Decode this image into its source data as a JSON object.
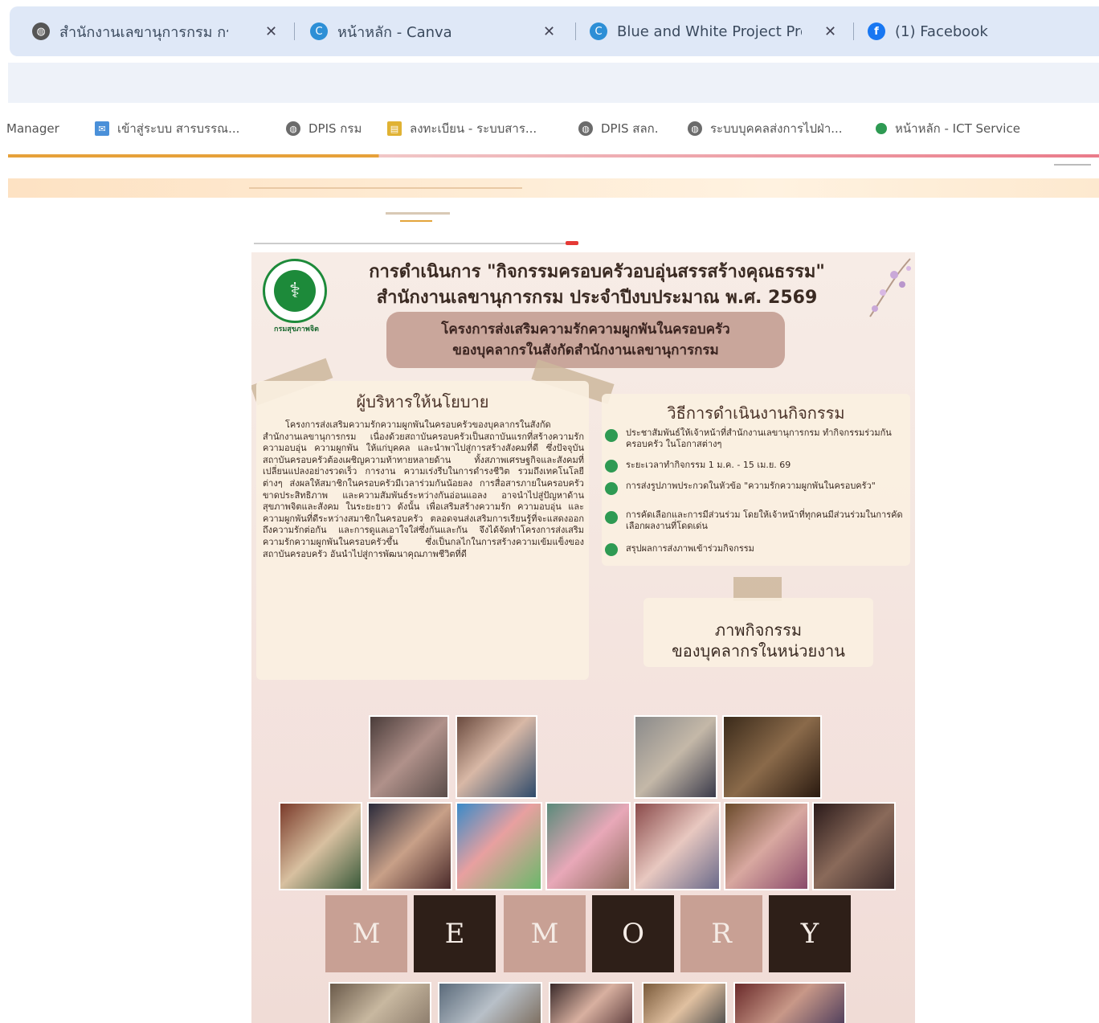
{
  "browser": {
    "tabs": [
      {
        "title": "สำนักงานเลขานุการกรม กรมสนั",
        "icon": "globe-icon"
      },
      {
        "title": "หน้าหลัก - Canva",
        "icon": "canva-icon"
      },
      {
        "title": "Blue and White Project Prop",
        "icon": "canva-icon"
      },
      {
        "title": "(1) Facebook",
        "icon": "facebook-icon"
      }
    ],
    "close_glyph": "✕",
    "bookmarks": [
      {
        "label": "Manager",
        "icon": "none"
      },
      {
        "label": "เข้าสู่ระบบ สารบรรณ...",
        "icon": "mail-icon"
      },
      {
        "label": "DPIS กรม",
        "icon": "globe-icon"
      },
      {
        "label": "ลงทะเบียน - ระบบสาร...",
        "icon": "folder-icon"
      },
      {
        "label": "DPIS สลก.",
        "icon": "globe-icon"
      },
      {
        "label": "ระบบบุคคลส่งการไปฝ่า...",
        "icon": "globe-icon"
      },
      {
        "label": "หน้าหลัก - ICT Service",
        "icon": "green-dot-icon"
      }
    ]
  },
  "poster": {
    "title_line1": "การดำเนินการ \"กิจกรรมครอบครัวอบอุ่นสรรสร้างคุณธรรม\"",
    "title_line2": "สำนักงานเลขานุการกรม ประจำปีงบประมาณ พ.ศ. 2569",
    "project_line1": "โครงการส่งเสริมความรักความผูกพันในครอบครัว",
    "project_line2": "ของบุคลากรในสังกัดสำนักงานเลขานุการกรม",
    "logo_caption": "กรมสุขภาพจิต",
    "policy_heading": "ผู้บริหารให้นโยบาย",
    "policy_body": "โครงการส่งเสริมความรักความผูกพันในครอบครัวของบุคลากรในสังกัดสำนักงานเลขานุการกรม เนื่องด้วยสถาบันครอบครัวเป็นสถาบันแรกที่สร้างความรัก ความอบอุ่น ความผูกพัน ให้แก่บุคคล และนำพาไปสู่การสร้างสังคมที่ดี ซึ่งปัจจุบันสถาบันครอบครัวต้องเผชิญความท้าทายหลายด้าน ทั้งสภาพเศรษฐกิจและสังคมที่เปลี่ยนแปลงอย่างรวดเร็ว การงาน ความเร่งรีบในการดำรงชีวิต รวมถึงเทคโนโลยีต่างๆ ส่งผลให้สมาชิกในครอบครัวมีเวลาร่วมกันน้อยลง การสื่อสารภายในครอบครัวขาดประสิทธิภาพ และความสัมพันธ์ระหว่างกันอ่อนแอลง อาจนำไปสู่ปัญหาด้านสุขภาพจิตและสังคม ในระยะยาว ดังนั้น เพื่อเสริมสร้างความรัก ความอบอุ่น และความผูกพันที่ดีระหว่างสมาชิกในครอบครัว ตลอดจนส่งเสริมการเรียนรู้ที่จะแสดงออกถึงความรักต่อกัน และการดูแลเอาใจใส่ซึ่งกันและกัน จึงได้จัดทำโครงการส่งเสริมความรักความผูกพันในครอบครัวขึ้น ซึ่งเป็นกลไกในการสร้างความเข้มแข็งของสถาบันครอบครัว อันนำไปสู่การพัฒนาคุณภาพชีวิตที่ดี",
    "method_heading": "วิธีการดำเนินงานกิจกรรม",
    "method_steps": [
      "ประชาสัมพันธ์ให้เจ้าหน้าที่สำนักงานเลขานุการกรม ทำกิจกรรมร่วมกันครอบครัว ในโอกาสต่างๆ",
      "ระยะเวลาทำกิจกรรม 1 ม.ค. - 15 เม.ย. 69",
      "การส่งรูปภาพประกวดในหัวข้อ \"ความรักความผูกพันในครอบครัว\"",
      "การคัดเลือกและการมีส่วนร่วม โดยให้เจ้าหน้าที่ทุกคนมีส่วนร่วมในการคัดเลือกผลงานที่โดดเด่น",
      "สรุปผลการส่งภาพเข้าร่วมกิจกรรม"
    ],
    "photos_heading_line1": "ภาพกิจกรรม",
    "photos_heading_line2": "ของบุคลากรในหน่วยงาน",
    "memory_letters": [
      "M",
      "E",
      "M",
      "O",
      "R",
      "Y"
    ],
    "colors": {
      "tile_light": "#c8a094",
      "tile_dark": "#2e1f18",
      "pill": "#c9a69b",
      "accent_green": "#2e9a53",
      "title_text": "#3a2a22"
    }
  }
}
